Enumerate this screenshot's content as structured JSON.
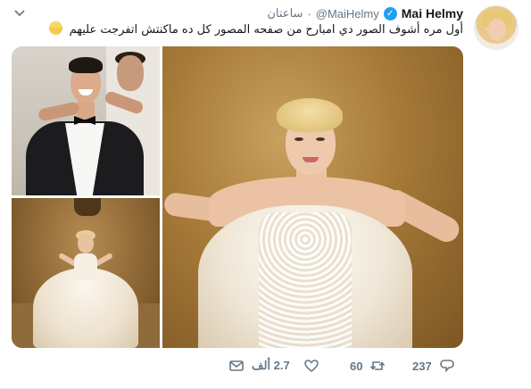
{
  "tweet": {
    "display_name": "Mai Helmy",
    "handle": "@MaiHelmy",
    "timestamp": "ساعتان",
    "separator": "·",
    "text": "أول مره أشوف الصور دي امبارح من صفحه المصور كل ده ماكنتش اتفرجت عليهم",
    "emoji_icon": "person-blond-hair-emoji"
  },
  "actions": {
    "reply_count": "237",
    "retweet_count": "60",
    "like_count": "2.7 ألف",
    "dm_icon": "envelope-icon",
    "like_icon": "heart-icon",
    "retweet_icon": "retweet-icon",
    "reply_icon": "speech-bubble-icon"
  },
  "colors": {
    "verified": "#1da1f2",
    "secondary_text": "#657786",
    "primary_text": "#14171a"
  }
}
